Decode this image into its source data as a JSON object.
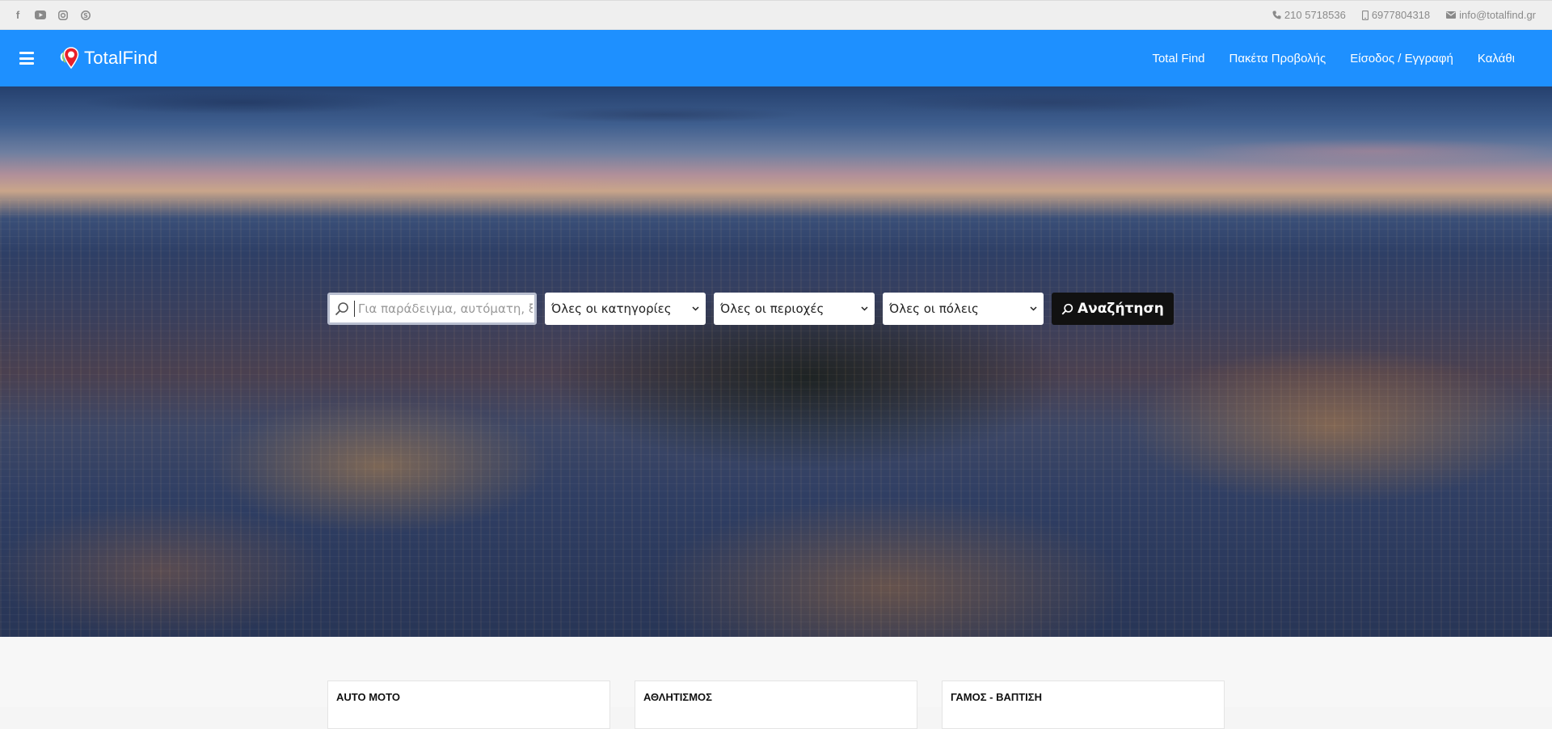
{
  "topbar": {
    "social": [
      "facebook-icon",
      "youtube-icon",
      "instagram-icon",
      "skype-icon"
    ],
    "phone": "210 5718536",
    "mobile": "6977804318",
    "email": "info@totalfind.gr"
  },
  "navbar": {
    "brand": "TotalFind",
    "links": [
      "Total Find",
      "Πακέτα Προβολής",
      "Είσοδος / Εγγραφή",
      "Καλάθι"
    ],
    "color": "#1e90ff"
  },
  "search": {
    "placeholder": "Για παράδειγμα, αυτόματη, ξενοδοχείο",
    "category": "Όλες οι κατηγορίες",
    "region": "Όλες οι περιοχές",
    "city": "Όλες οι πόλεις",
    "button": "Αναζήτηση"
  },
  "categories": [
    "AUTO MOTO",
    "ΑΘΛΗΤΙΣΜΟΣ",
    "ΓΑΜΟΣ - ΒΑΠΤΙΣΗ"
  ]
}
